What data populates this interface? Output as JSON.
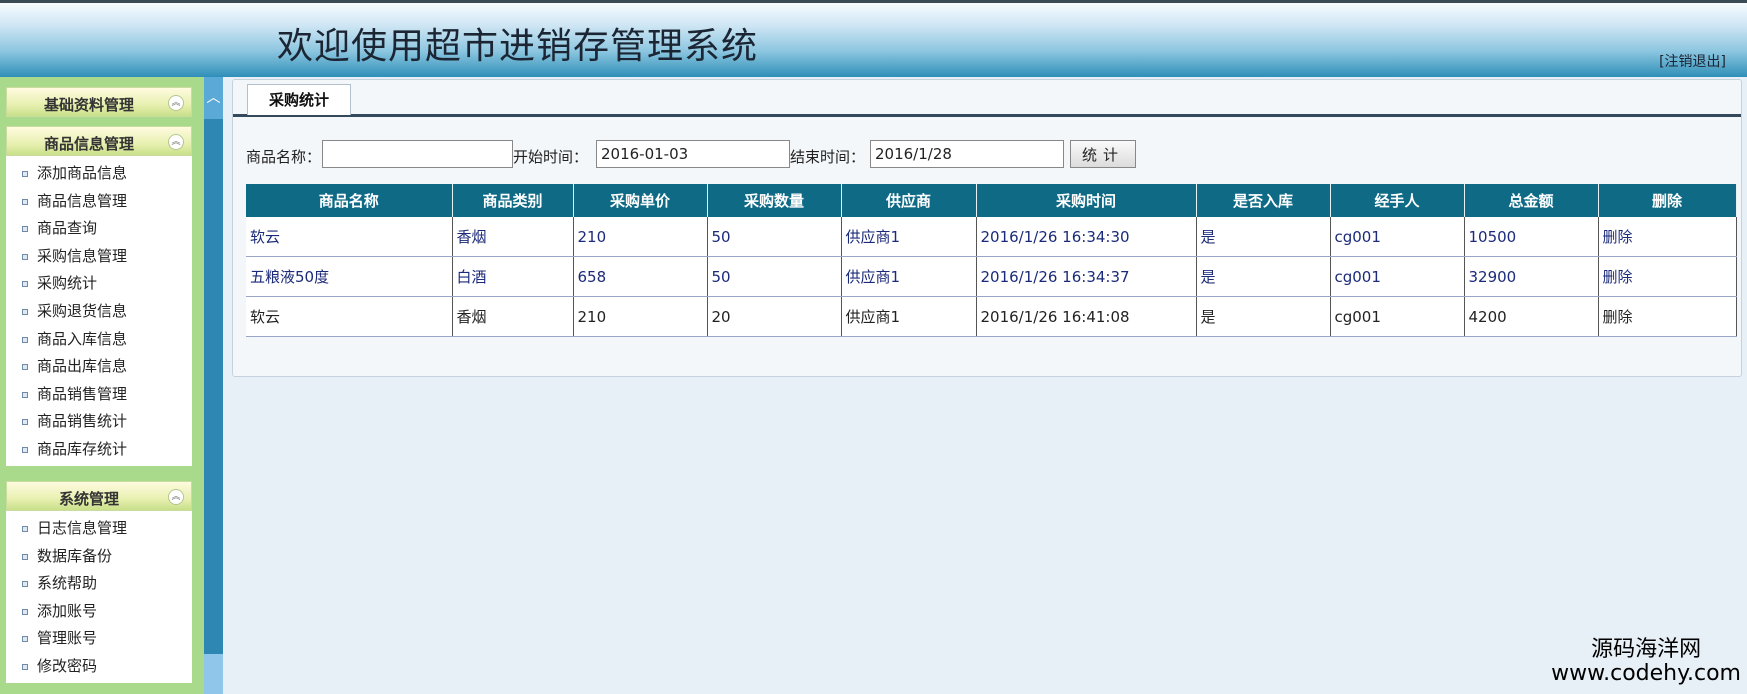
{
  "header": {
    "title": "欢迎使用超市进销存管理系统",
    "logout": "[注销退出]"
  },
  "sidebar": {
    "groups": [
      {
        "title": "基础资料管理",
        "items": []
      },
      {
        "title": "商品信息管理",
        "items": [
          "添加商品信息",
          "商品信息管理",
          "商品查询",
          "采购信息管理",
          "采购统计",
          "采购退货信息",
          "商品入库信息",
          "商品出库信息",
          "商品销售管理",
          "商品销售统计",
          "商品库存统计"
        ]
      },
      {
        "title": "系统管理",
        "items": [
          "日志信息管理",
          "数据库备份",
          "系统帮助",
          "添加账号",
          "管理账号",
          "修改密码"
        ]
      }
    ]
  },
  "tab": {
    "label": "采购统计"
  },
  "filter": {
    "name_label": "商品名称：",
    "name_value": "",
    "start_label": "开始时间：",
    "start_value": "2016-01-03",
    "end_label": "结束时间：",
    "end_value": "2016/1/28",
    "button": "统计"
  },
  "table": {
    "columns": [
      "商品名称",
      "商品类别",
      "采购单价",
      "采购数量",
      "供应商",
      "采购时间",
      "是否入库",
      "经手人",
      "总金额",
      "删除"
    ],
    "rows": [
      [
        "软云",
        "香烟",
        "210",
        "50",
        "供应商1",
        "2016/1/26 16:34:30",
        "是",
        "cg001",
        "10500",
        "删除"
      ],
      [
        "五粮液50度",
        "白酒",
        "658",
        "50",
        "供应商1",
        "2016/1/26 16:34:37",
        "是",
        "cg001",
        "32900",
        "删除"
      ],
      [
        "软云",
        "香烟",
        "210",
        "20",
        "供应商1",
        "2016/1/26 16:41:08",
        "是",
        "cg001",
        "4200",
        "删除"
      ]
    ]
  },
  "watermark": {
    "line1": "源码海洋网",
    "line2": "www.codehy.com"
  }
}
